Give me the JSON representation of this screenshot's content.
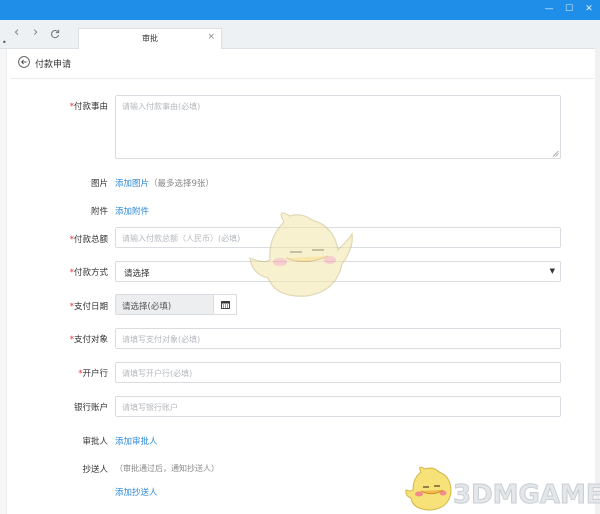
{
  "window": {
    "controls": [
      "—",
      "☐",
      "✕"
    ]
  },
  "browser": {
    "tab_title": "审批",
    "tab_close": "×",
    "side_mark": "•"
  },
  "header": {
    "title": "付款申请"
  },
  "form": {
    "reason": {
      "label": "付款事由",
      "placeholder": "请输入付款事由(必填)"
    },
    "images": {
      "label": "图片",
      "link": "添加图片",
      "hint": "（最多选择9张）"
    },
    "attachments": {
      "label": "附件",
      "link": "添加附件"
    },
    "amount": {
      "label": "付款总额",
      "placeholder": "请输入付款总额（人民币）(必填)"
    },
    "method": {
      "label": "付款方式",
      "value": "请选择"
    },
    "date": {
      "label": "支付日期",
      "value": "请选择(必填)"
    },
    "payee": {
      "label": "支付对象",
      "placeholder": "请填写支付对象(必填)"
    },
    "bank": {
      "label": "开户行",
      "placeholder": "请填写开户行(必填)"
    },
    "account": {
      "label": "银行账户",
      "placeholder": "请填写银行账户"
    },
    "approver": {
      "label": "审批人",
      "link": "添加审批人"
    },
    "cc": {
      "label": "抄送人",
      "hint": "（审批通过后，通知抄送人）",
      "link": "添加抄送人"
    },
    "required_mark": "*"
  },
  "watermark": {
    "text": "3DMGAME"
  },
  "colors": {
    "titlebar": "#1e8ee8",
    "link": "#2d89d8",
    "required": "#e02d2d"
  }
}
